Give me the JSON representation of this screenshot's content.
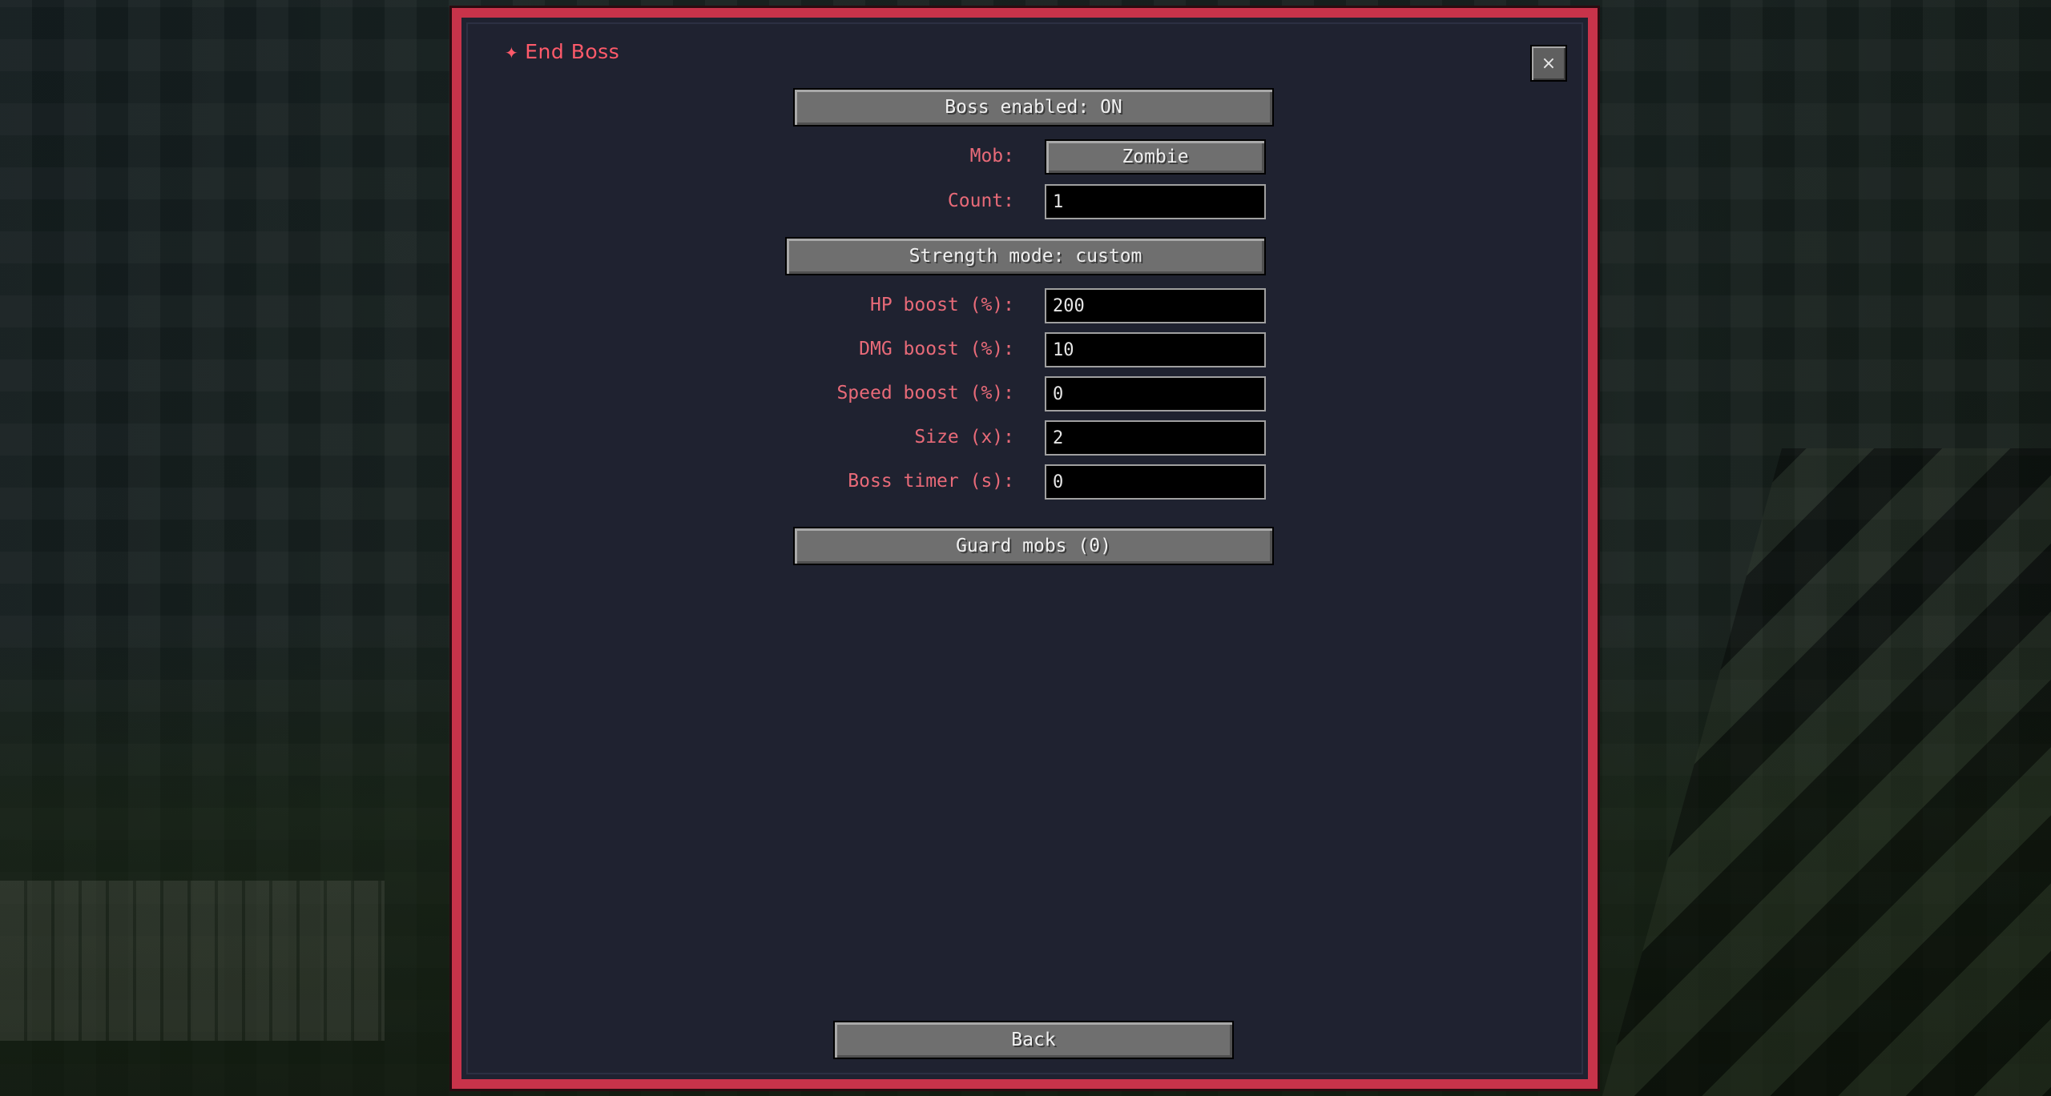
{
  "panel": {
    "title": "End Boss",
    "title_icon": "✦",
    "close_label": "×",
    "accent_color": "#c8334a",
    "title_color": "#ff5a6a",
    "label_color": "#e86a78"
  },
  "boss_toggle": {
    "label": "Boss enabled: ON"
  },
  "mob": {
    "label": "Mob:",
    "value": "Zombie"
  },
  "count": {
    "label": "Count:",
    "value": "1"
  },
  "strength_mode": {
    "label": "Strength mode: custom"
  },
  "hp_boost": {
    "label": "HP boost (%):",
    "value": "200"
  },
  "dmg_boost": {
    "label": "DMG boost (%):",
    "value": "10"
  },
  "speed_boost": {
    "label": "Speed boost (%):",
    "value": "0"
  },
  "size": {
    "label": "Size (x):",
    "value": "2"
  },
  "boss_timer": {
    "label": "Boss timer (s):",
    "value": "0"
  },
  "guard_mobs": {
    "label": "Guard mobs (0)"
  },
  "back": {
    "label": "Back"
  }
}
